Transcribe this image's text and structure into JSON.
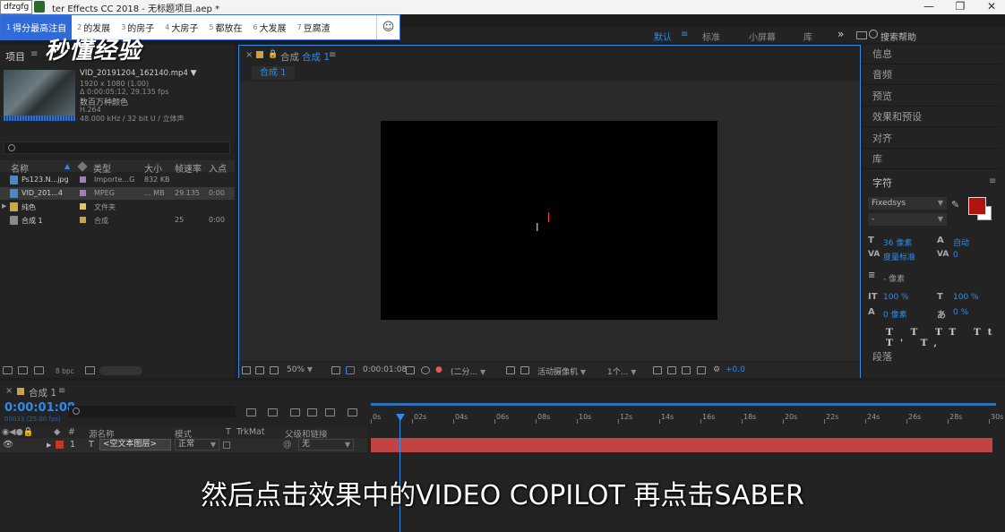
{
  "window": {
    "ime_badge": "dfzgfg",
    "title": "ter Effects CC 2018 - 无标题项目.aep *",
    "minimize": "—",
    "maximize": "❐",
    "close": "✕"
  },
  "ime": {
    "candidates": [
      {
        "n": "1",
        "text": "得分最高注自",
        "selected": true
      },
      {
        "n": "2",
        "text": "的发展"
      },
      {
        "n": "3",
        "text": "的房子"
      },
      {
        "n": "4",
        "text": "大房子"
      },
      {
        "n": "5",
        "text": "都放在"
      },
      {
        "n": "6",
        "text": "大发展"
      },
      {
        "n": "7",
        "text": "豆腐渣"
      }
    ],
    "emoji": "☺"
  },
  "watermark": "秒懂经验",
  "workspace": {
    "default": "默认",
    "menu_icon": "≡",
    "standard": "标准",
    "small_screen": "小屏幕",
    "library": "库",
    "more": "»",
    "search_placeholder": "搜索帮助"
  },
  "project": {
    "tab": "项目",
    "menu": "≡",
    "file_name": "VID_20191204_162140.mp4",
    "meta": [
      "1920 x 1080 (1.00)",
      "Δ 0:00:05:12, 29.135 fps",
      "数百万种颜色",
      "H.264",
      "48.000 kHz / 32 bit U / 立体声"
    ],
    "columns": [
      "名称",
      "类型",
      "大小",
      "帧速率",
      "入点"
    ],
    "rows": [
      {
        "name": "Ps123.N...jpg",
        "type": "Importe...G",
        "size": "832 KB",
        "fps": "",
        "in": "",
        "tag": "#9b7fbf",
        "icon": "#4d87c7"
      },
      {
        "name": "VID_201...4",
        "type": "MPEG",
        "size": "... MB",
        "fps": "29.135",
        "in": "0:00",
        "tag": "#9b7fbf",
        "icon": "#4d87c7",
        "selected": true
      },
      {
        "name": "纯色",
        "type": "文件夹",
        "size": "",
        "fps": "",
        "in": "",
        "tag": "#e3c454",
        "icon": "#c9a649"
      },
      {
        "name": "合成 1",
        "type": "合成",
        "size": "",
        "fps": "25",
        "in": "0:00",
        "tag": "#c7a24a",
        "icon": "#8a8a8a"
      }
    ],
    "bpc": "8 bpc"
  },
  "composition": {
    "tab_label": "合成",
    "tab_name": "合成 1",
    "menu": "≡",
    "crumb": "合成 1",
    "zoom": "50%",
    "timecode": "0:00:01:08",
    "resolution": "(二分...",
    "camera": "活动摄像机",
    "views": "1个...",
    "exposure": "+0.0"
  },
  "right_panels": {
    "items": [
      "信息",
      "音频",
      "预览",
      "效果和预设",
      "对齐",
      "库"
    ],
    "character": "字符",
    "font": "Fixedsys",
    "style": "-",
    "font_size": "36 像素",
    "leading": "自动",
    "kerning": "度量标准",
    "tracking": "0",
    "stroke": "- 像素",
    "vscale": "100 %",
    "hscale": "100 %",
    "baseline": "0 像素",
    "tsume": "0 %",
    "text_styles": "T T TT Tt T' T,",
    "paragraph": "段落",
    "fill_color": "#b3130d"
  },
  "timeline": {
    "tab": "合成 1",
    "menu": "≡",
    "timecode": "0:00:01:08",
    "timecode_sub": "00033 (25.00 fps)",
    "columns": {
      "num": "#",
      "source": "源名称",
      "mode": "模式",
      "t": "T",
      "trkmat": "TrkMat",
      "parent": "父级和链接"
    },
    "layer": {
      "index": "1",
      "type": "T",
      "name": "<空文本图层>",
      "mode": "正常",
      "parent": "无"
    },
    "ruler": [
      "0s",
      "02s",
      "04s",
      "06s",
      "08s",
      "10s",
      "12s",
      "14s",
      "16s",
      "18s",
      "20s",
      "22s",
      "24s",
      "26s",
      "28s",
      "30s"
    ],
    "playhead_seconds": 1.32
  },
  "subtitle": "然后点击效果中的VIDEO COPILOT  再点击SABER"
}
